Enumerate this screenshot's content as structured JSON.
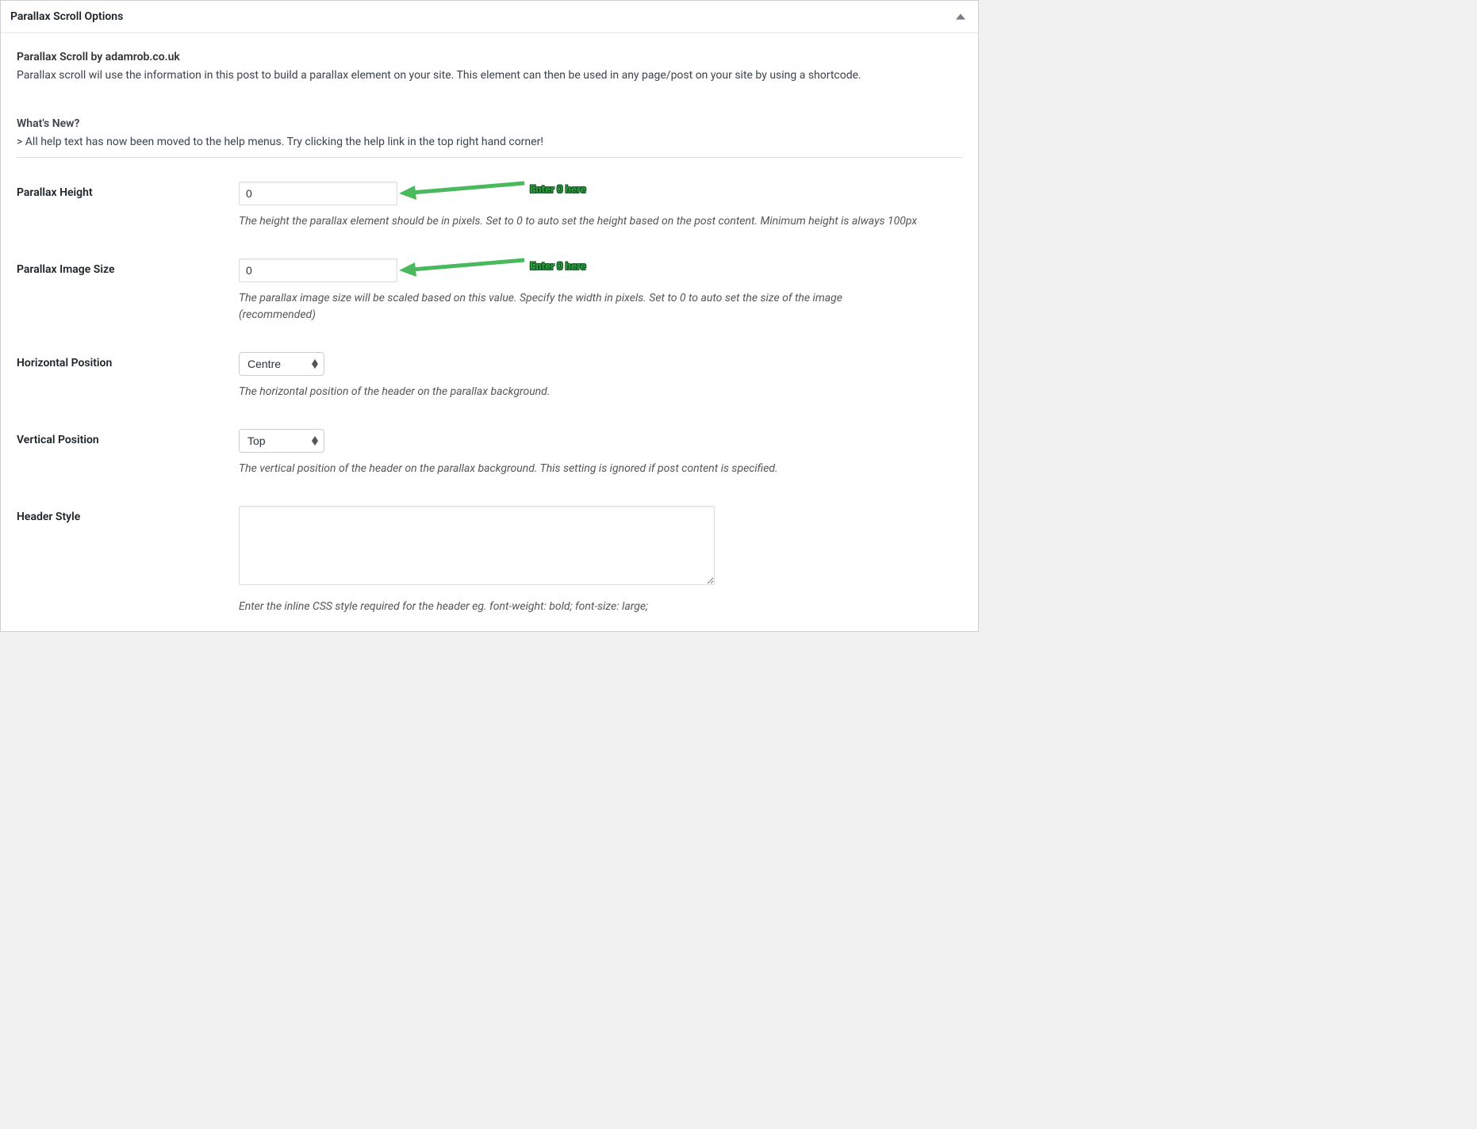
{
  "panel": {
    "title": "Parallax Scroll Options",
    "intro_title": "Parallax Scroll by adamrob.co.uk",
    "intro_text": "Parallax scroll wil use the information in this post to build a parallax element on your site. This element can then be used in any page/post on your site by using a shortcode.",
    "whats_new_label": "What's New?",
    "whats_new_text": "> All help text has now been moved to the help menus. Try clicking the help link in the top right hand corner!"
  },
  "fields": {
    "parallax_height": {
      "label": "Parallax Height",
      "value": "0",
      "help": "The height the parallax element should be in pixels. Set to 0 to auto set the height based on the post content. Minimum height is always 100px"
    },
    "parallax_image_size": {
      "label": "Parallax Image Size",
      "value": "0",
      "help": "The parallax image size will be scaled based on this value. Specify the width in pixels. Set to 0 to auto set the size of the image (recommended)"
    },
    "horizontal_position": {
      "label": "Horizontal Position",
      "value": "Centre",
      "help": "The horizontal position of the header on the parallax background."
    },
    "vertical_position": {
      "label": "Vertical Position",
      "value": "Top",
      "help": "The vertical position of the header on the parallax background. This setting is ignored if post content is specified."
    },
    "header_style": {
      "label": "Header Style",
      "value": "",
      "help": "Enter the inline CSS style required for the header eg. font-weight: bold; font-size: large;"
    }
  },
  "annotations": {
    "enter_zero_1": "Enter 0 here",
    "enter_zero_2": "Enter 0 here"
  }
}
